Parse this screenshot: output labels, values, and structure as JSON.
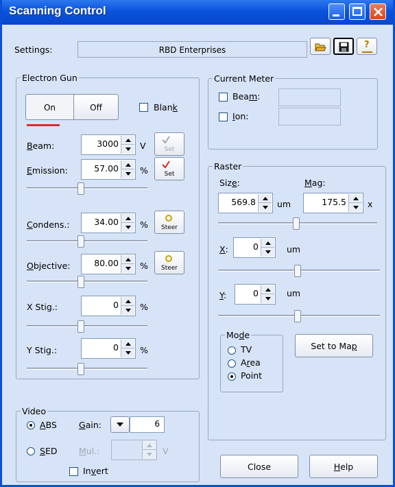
{
  "window": {
    "title": "Scanning Control"
  },
  "settings": {
    "label": "Settings:",
    "value": "RBD Enterprises",
    "help_glyph": "?"
  },
  "electron_gun": {
    "group_label": "Electron Gun",
    "on_label": "On",
    "off_label": "Off",
    "blank_label_pre": "Blan",
    "blank_label_key": "k",
    "beam": {
      "label_key": "B",
      "label_rest": "eam:",
      "value": "3000",
      "unit": "V",
      "button": "Set"
    },
    "emission": {
      "label_key": "E",
      "label_rest": "mission:",
      "value": "57.00",
      "unit": "%",
      "button": "Set",
      "slider": 0.45
    },
    "condens": {
      "label_key": "C",
      "label_rest": "ondens.:",
      "value": "34.00",
      "unit": "%",
      "button": "Steer",
      "slider": 0.45
    },
    "objective": {
      "label_key": "O",
      "label_rest": "bjective:",
      "value": "80.00",
      "unit": "%",
      "button": "Steer",
      "slider": 0.45
    },
    "xstig": {
      "label": "X Stig.:",
      "value": "0",
      "unit": "%",
      "slider": 0.45
    },
    "ystig": {
      "label": "Y Stig.:",
      "value": "0",
      "unit": "%",
      "slider": 0.45
    }
  },
  "current_meter": {
    "group_label": "Current Meter",
    "beam_pre": "Bea",
    "beam_key": "m",
    "beam_post": ":",
    "ion_key": "I",
    "ion_rest": "on:"
  },
  "raster": {
    "group_label": "Raster",
    "size_pre": "Siz",
    "size_key": "e",
    "size_post": ":",
    "mag_key": "M",
    "mag_rest": "ag:",
    "size_value": "569.8",
    "size_unit": "um",
    "mag_value": "175.5",
    "mag_unit": "x",
    "size_slider": 0.49,
    "x_key": "X",
    "x_rest": ":",
    "x_value": "0",
    "x_unit": "um",
    "x_slider": 0.49,
    "y_key": "Y",
    "y_rest": ":",
    "y_value": "0",
    "y_unit": "um",
    "y_slider": 0.49,
    "mode": {
      "group_pre": "Mo",
      "group_key": "d",
      "group_post": "e",
      "tv": "TV",
      "area_pre": "A",
      "area_key": "r",
      "area_post": "ea",
      "point": "Point"
    },
    "set_to_map_pre": "Set to Ma",
    "set_to_map_key": "p"
  },
  "video": {
    "group_label": "Video",
    "abs_key": "A",
    "abs_rest": "BS",
    "gain_key": "G",
    "gain_rest": "ain:",
    "gain_value": "6",
    "sed_key": "S",
    "sed_rest": "ED",
    "mul_key": "M",
    "mul_rest": "ul.:",
    "mul_unit": "V",
    "invert_pre": "In",
    "invert_key": "v",
    "invert_post": "ert"
  },
  "footer": {
    "close_label": "Close",
    "help_key": "H",
    "help_rest": "elp"
  },
  "colors": {
    "titlebar": "#0a53dc",
    "on_indicator": "#e3262e",
    "dialog_bg": "#d7e3f6"
  }
}
